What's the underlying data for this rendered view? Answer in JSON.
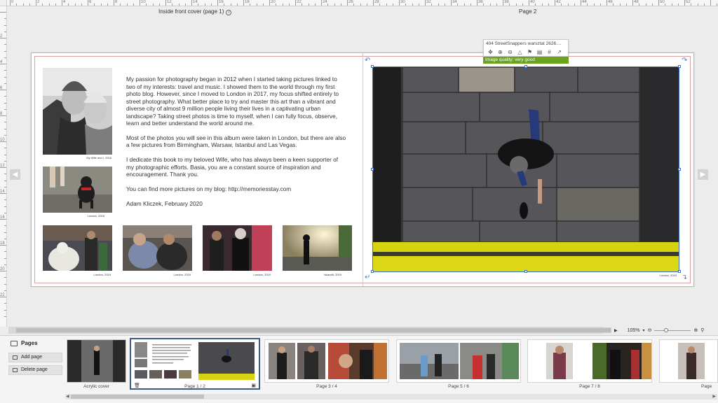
{
  "canvas": {
    "left_page_label": "Inside front cover (page 1)",
    "right_page_label": "Page 2",
    "ruler_top_numbers": [
      "0",
      "2",
      "4",
      "6",
      "8",
      "10",
      "12",
      "14",
      "16",
      "18",
      "20",
      "22",
      "24",
      "26",
      "28",
      "30",
      "32",
      "34",
      "36",
      "38",
      "40",
      "42",
      "44",
      "46",
      "48",
      "50",
      "52"
    ],
    "ruler_left_numbers": [
      "2",
      "4",
      "6",
      "8",
      "10",
      "12",
      "14",
      "16",
      "18",
      "20",
      "22"
    ]
  },
  "left_page": {
    "captions": {
      "portrait": "My Wife and I, 2016",
      "dog": "London, 2018",
      "t1": "London, 2019",
      "t2": "London, 2019",
      "t3": "London, 2019",
      "t4": "Iskandit, 2019"
    },
    "paragraphs": [
      "My passion for photography began in 2012 when I started taking pictures linked to two of my interests: travel and music. I showed them to the world through my first photo blog. However, since I moved to London in 2017, my focus shifted entirely to street photography. What better place to try and master this art than a vibrant and diverse city of almost 9 million people living their lives in a captivating urban landscape? Taking street photos is time to myself, when I can fully focus, observe, learn and better understand the world around me.",
      "Most of the photos you will see in this album were taken in London, but there are also a few pictures from Birmingham, Warsaw, Istanbul and Las Vegas.",
      "I dedicate this book to my beloved Wife, who has always been a keen supporter of my photographic efforts. Basia, you are a constant source of inspiration and encouragement. Thank you.",
      "You can find more pictures on my blog: http://memoriesstay.com",
      "Adam Kliczek, February 2020"
    ]
  },
  "right_page": {
    "caption": "London, 2019",
    "photo_toolbar": {
      "filename": "404 StreetSnappers warsztat 2626....",
      "quality": "Image quality: very good"
    }
  },
  "zoom": {
    "value": "105%"
  },
  "panel": {
    "title": "Pages",
    "add_page": "Add page",
    "delete_page": "Delete page",
    "thumbnails": [
      {
        "label": "Acrylic cover"
      },
      {
        "label": "Page 1 / 2"
      },
      {
        "label": "Page 3 / 4"
      },
      {
        "label": "Page 5 / 6"
      },
      {
        "label": "Page 7 / 8"
      },
      {
        "label": "Page"
      }
    ]
  },
  "colors": {
    "selection": "#3a6fd8",
    "quality_good": "#6aa31c",
    "bleed_line": "#d8a0a0"
  }
}
